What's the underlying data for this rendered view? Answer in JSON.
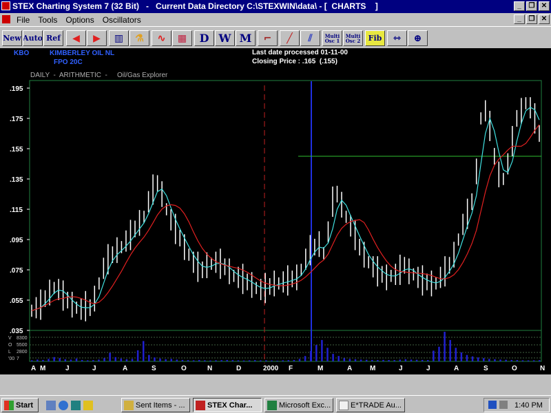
{
  "window": {
    "title": "STEX Charting System 7 (32 Bit)   -   Current Data Directory C:\\STEXWIN\\data\\ - [  CHARTS    ]"
  },
  "menu": {
    "items": [
      "File",
      "Tools",
      "Options",
      "Oscillators"
    ]
  },
  "toolbar": {
    "buttons": [
      {
        "label": "New",
        "name": "new-button"
      },
      {
        "label": "Auto",
        "name": "auto-button"
      },
      {
        "label": "Ref",
        "name": "ref-button"
      },
      {
        "label": "",
        "name": "scroll-left-icon"
      },
      {
        "label": "",
        "name": "scroll-right-icon"
      },
      {
        "label": "",
        "name": "bar-chart-icon"
      },
      {
        "label": "",
        "name": "flask-icon"
      },
      {
        "label": "",
        "name": "line-chart-icon"
      },
      {
        "label": "",
        "name": "grid-chart-icon"
      },
      {
        "label": "D",
        "name": "daily-button"
      },
      {
        "label": "W",
        "name": "weekly-button"
      },
      {
        "label": "M",
        "name": "monthly-button"
      },
      {
        "label": "",
        "name": "trendline-corner-icon"
      },
      {
        "label": "",
        "name": "trendline-icon"
      },
      {
        "label": "",
        "name": "channel-icon"
      },
      {
        "label": "Multi Osc 1",
        "name": "multi-osc1-button"
      },
      {
        "label": "Multi Osc 2",
        "name": "multi-osc2-button"
      },
      {
        "label": "Fib",
        "name": "fib-button"
      },
      {
        "label": "",
        "name": "measure-icon"
      },
      {
        "label": "",
        "name": "zoom-icon"
      }
    ]
  },
  "chart_header": {
    "code": "KBO",
    "company": "KIMBERLEY OIL NL",
    "security": "FPO 20C",
    "last_date": "Last date processed 01-11-00",
    "closing_price": "Closing Price : .165  (.155)",
    "chart_type": "DAILY  -  ARITHMETIC  -",
    "sector": "Oil/Gas Explorer"
  },
  "chart_data": {
    "type": "bar",
    "y_tick_labels": [
      ".195",
      ".175",
      ".155",
      ".135",
      ".115",
      ".095",
      ".075",
      ".055",
      ".035"
    ],
    "y_ticks": [
      0.195,
      0.175,
      0.155,
      0.135,
      0.115,
      0.095,
      0.075,
      0.055,
      0.035
    ],
    "ylim": [
      0.035,
      0.2
    ],
    "x_month_labels": [
      "A",
      "M",
      "J",
      "J",
      "A",
      "S",
      "O",
      "N",
      "D",
      "2000",
      "F",
      "M",
      "A",
      "M",
      "J",
      "J",
      "A",
      "S",
      "O",
      "N"
    ],
    "volume_labels": [
      "V",
      "O",
      "L",
      "'00"
    ],
    "volume_scale_labels": [
      "8300",
      "5500",
      "2800",
      "7"
    ],
    "horizontal_line_value": 0.15,
    "colors": {
      "price": "#ffffff",
      "fast_ma": "#40e0e0",
      "slow_ma": "#e02020",
      "volume": "#2020d0",
      "hline": "#30c030",
      "year_divider": "#c02020",
      "cursor": "#2030e0",
      "axis_text": "#ffffff",
      "header_blue": "#3060ff",
      "header_white": "#ffffff",
      "subheader": "#b0b0b0"
    },
    "close": [
      0.048,
      0.05,
      0.052,
      0.056,
      0.06,
      0.063,
      0.062,
      0.058,
      0.055,
      0.052,
      0.05,
      0.049,
      0.051,
      0.05,
      0.056,
      0.066,
      0.076,
      0.082,
      0.085,
      0.088,
      0.09,
      0.094,
      0.098,
      0.102,
      0.106,
      0.11,
      0.12,
      0.128,
      0.132,
      0.125,
      0.115,
      0.108,
      0.102,
      0.096,
      0.09,
      0.085,
      0.08,
      0.077,
      0.075,
      0.078,
      0.079,
      0.08,
      0.079,
      0.077,
      0.074,
      0.071,
      0.07,
      0.069,
      0.067,
      0.065,
      0.063,
      0.062,
      0.063,
      0.064,
      0.066,
      0.066,
      0.067,
      0.068,
      0.069,
      0.07,
      0.075,
      0.082,
      0.088,
      0.09,
      0.092,
      0.086,
      0.1,
      0.12,
      0.125,
      0.118,
      0.11,
      0.104,
      0.098,
      0.09,
      0.085,
      0.08,
      0.077,
      0.074,
      0.072,
      0.07,
      0.071,
      0.072,
      0.075,
      0.078,
      0.074,
      0.072,
      0.07,
      0.068,
      0.067,
      0.066,
      0.066,
      0.07,
      0.074,
      0.078,
      0.085,
      0.095,
      0.105,
      0.112,
      0.12,
      0.14,
      0.175,
      0.18,
      0.17,
      0.15,
      0.138,
      0.135,
      0.145,
      0.16,
      0.175,
      0.18,
      0.185,
      0.182,
      0.175,
      0.165
    ],
    "volume": [
      300,
      500,
      400,
      700,
      1200,
      900,
      600,
      500,
      800,
      400,
      300,
      350,
      500,
      900,
      2400,
      1200,
      800,
      600,
      700,
      3100,
      5700,
      1800,
      1100,
      800,
      600,
      700,
      500,
      400,
      350,
      300,
      400,
      300,
      250,
      300,
      350,
      400,
      350,
      300,
      250,
      300,
      350,
      280,
      300,
      250,
      200,
      300,
      350,
      400,
      700,
      1500,
      2900,
      4600,
      6000,
      3800,
      2100,
      1500,
      900,
      700,
      600,
      500,
      450,
      400,
      380,
      420,
      380,
      360,
      500,
      600,
      500,
      450,
      400,
      380,
      3000,
      4100,
      8300,
      6000,
      3800,
      2500,
      1800,
      1400,
      1100,
      900,
      700,
      600,
      500,
      450,
      400,
      380,
      300,
      280,
      300,
      350
    ]
  },
  "taskbar": {
    "start_label": "Start",
    "tasks": [
      "Sent Items - ...",
      "STEX Char...",
      "Microsoft Exc...",
      "E*TRADE Au..."
    ],
    "clock": "1:40 PM"
  }
}
